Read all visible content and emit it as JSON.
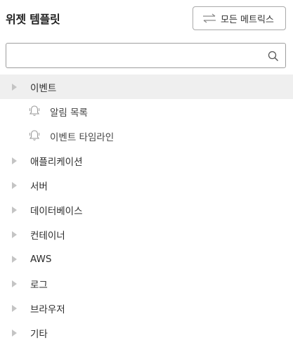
{
  "header": {
    "title": "위젯 템플릿",
    "all_metrics_label": "모든 메트릭스",
    "swap_icon": "swap-arrows-icon"
  },
  "search": {
    "value": "",
    "placeholder": "",
    "icon": "search-icon"
  },
  "tree": {
    "expanded_group": {
      "label": "이벤트",
      "children": [
        {
          "label": "알림 목록",
          "icon": "bell-icon"
        },
        {
          "label": "이벤트 타임라인",
          "icon": "bell-icon"
        }
      ]
    },
    "groups": [
      {
        "label": "애플리케이션"
      },
      {
        "label": "서버"
      },
      {
        "label": "데이터베이스"
      },
      {
        "label": "컨테이너"
      },
      {
        "label": "AWS"
      },
      {
        "label": "로그"
      },
      {
        "label": "브라우저"
      },
      {
        "label": "기타"
      }
    ]
  },
  "colors": {
    "selected_row_bg": "#efefef",
    "caret": "#c4c4c4",
    "border": "#a9a9a9"
  }
}
